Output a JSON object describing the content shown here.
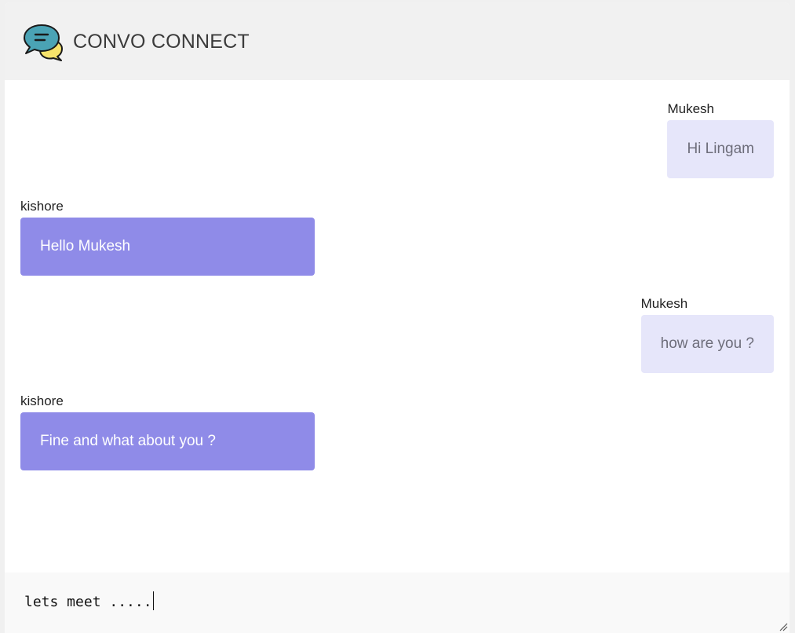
{
  "header": {
    "title": "CONVO CONNECT",
    "logo_icon": "chat-bubbles-icon"
  },
  "messages": [
    {
      "sender": "Mukesh",
      "text": "Hi Lingam",
      "side": "right"
    },
    {
      "sender": "kishore",
      "text": "Hello Mukesh",
      "side": "left"
    },
    {
      "sender": "Mukesh",
      "text": "how are you ?",
      "side": "right"
    },
    {
      "sender": "kishore",
      "text": "Fine and what about you ?",
      "side": "left"
    }
  ],
  "composer": {
    "value": "lets meet ....."
  },
  "colors": {
    "header_bg": "#f1f1f1",
    "own_bubble": "#e6e6fa",
    "other_bubble": "#8f8be8",
    "logo_teal": "#4aa3b5",
    "logo_yellow": "#f7e36b"
  }
}
